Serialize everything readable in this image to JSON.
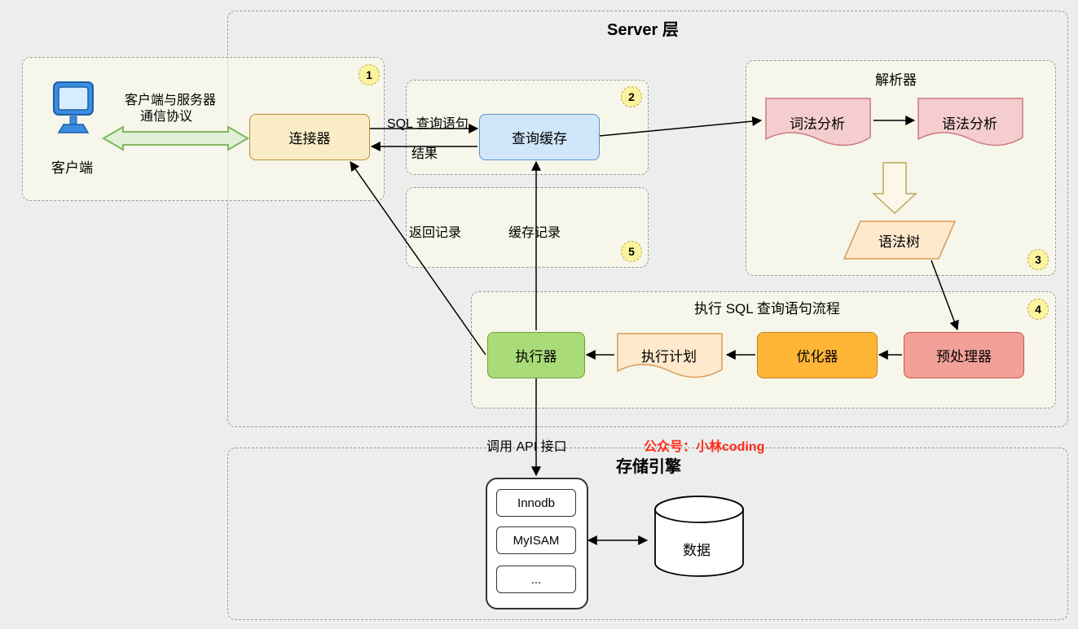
{
  "titles": {
    "server": "Server 层",
    "storage": "存储引擎",
    "parser": "解析器",
    "execFlow": "执行 SQL 查询语句流程"
  },
  "client": {
    "label": "客户端",
    "protocolLine1": "客户端与服务器",
    "protocolLine2": "通信协议"
  },
  "nodes": {
    "connector": "连接器",
    "queryCache": "查询缓存",
    "lexical": "词法分析",
    "syntax": "语法分析",
    "syntaxTree": "语法树",
    "preprocessor": "预处理器",
    "optimizer": "优化器",
    "execPlan": "执行计划",
    "executor": "执行器",
    "data": "数据",
    "innodb": "Innodb",
    "myisam": "MyISAM",
    "dots": "..."
  },
  "edges": {
    "sqlQuery": "SQL 查询语句",
    "result": "结果",
    "returnRecords": "返回记录",
    "cacheRecords": "缓存记录",
    "callApi": "调用 API 接口"
  },
  "badges": {
    "b1": "1",
    "b2": "2",
    "b3": "3",
    "b4": "4",
    "b5": "5"
  },
  "watermark": "公众号：小林coding"
}
